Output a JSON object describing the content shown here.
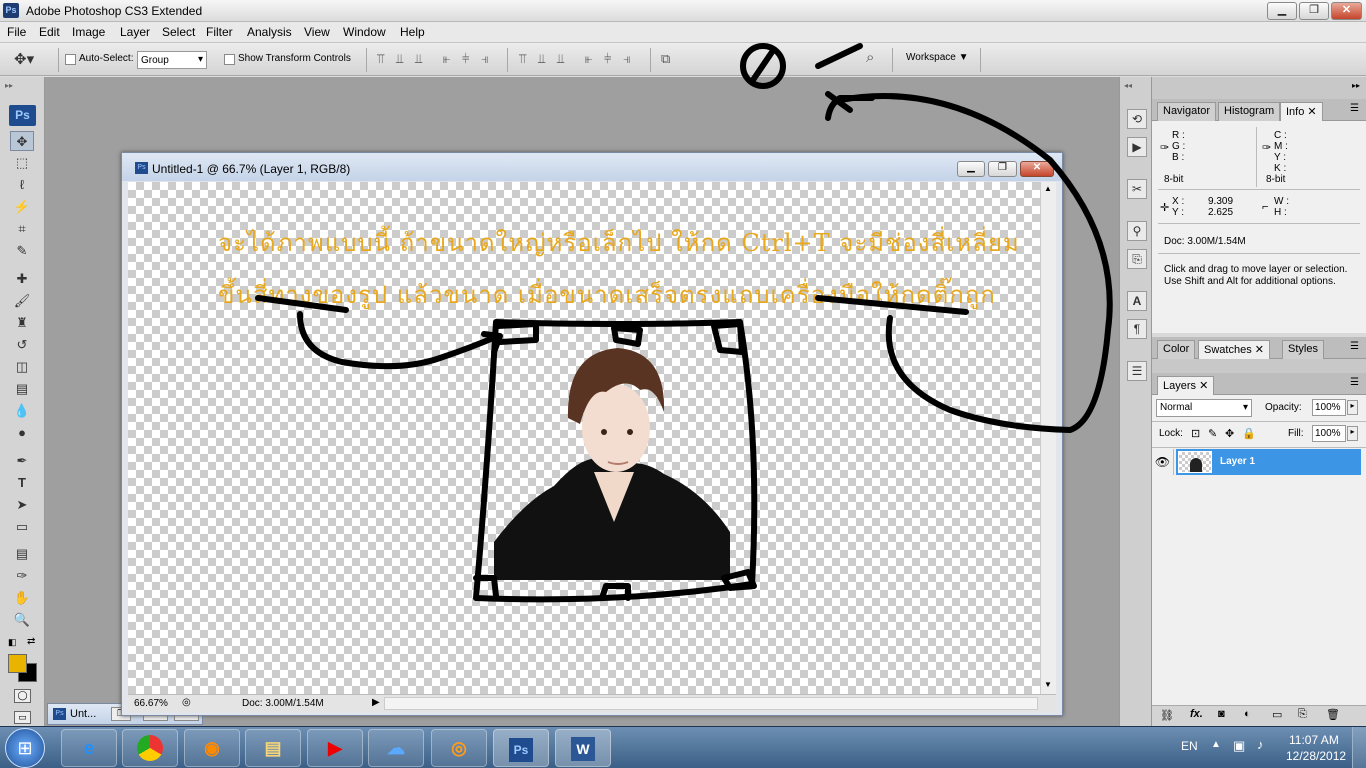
{
  "app": {
    "title": "Adobe Photoshop CS3 Extended"
  },
  "menu": [
    "File",
    "Edit",
    "Image",
    "Layer",
    "Select",
    "Filter",
    "Analysis",
    "View",
    "Window",
    "Help"
  ],
  "options": {
    "auto_select_label": "Auto-Select:",
    "auto_select_value": "Group",
    "show_transform_label": "Show Transform Controls",
    "workspace_label": "Workspace"
  },
  "document": {
    "title": "Untitled-1 @ 66.7% (Layer 1, RGB/8)",
    "zoom": "66.67%",
    "doc_size": "Doc: 3.00M/1.54M",
    "canvas_text_line1": "จะได้ภาพแบบนี้ ถ้าขนาดใหญ่หรือเล็กไป ให้กด Ctrl+T จะมีช่องสี่เหลี่ยม",
    "canvas_text_line2": "ขึ้นสี่ทางของรูป แล้วขนาด เมื่อขนาดเสร็จตรงแถบเครื่องมือให้กดติ๊กถูก"
  },
  "minimized_doc": {
    "label": "Unt..."
  },
  "info_panel": {
    "tabs": [
      "Navigator",
      "Histogram",
      "Info"
    ],
    "rgb_labels": [
      "R :",
      "G :",
      "B :"
    ],
    "cmyk_labels": [
      "C :",
      "M :",
      "Y :",
      "K :"
    ],
    "bit_left": "8-bit",
    "bit_right": "8-bit",
    "x_label": "X :",
    "x_value": "9.309",
    "y_label": "Y :",
    "y_value": "2.625",
    "w_label": "W :",
    "h_label": "H :",
    "doc_size": "Doc: 3.00M/1.54M",
    "help_text": "Click and drag to move layer or selection.  Use Shift and Alt for additional options."
  },
  "color_panel": {
    "tabs": [
      "Color",
      "Swatches",
      "Styles"
    ]
  },
  "layers_panel": {
    "tab": "Layers",
    "blend_mode": "Normal",
    "opacity_label": "Opacity:",
    "opacity_value": "100%",
    "lock_label": "Lock:",
    "fill_label": "Fill:",
    "fill_value": "100%",
    "layer_name": "Layer 1"
  },
  "taskbar": {
    "language": "EN",
    "time": "11:07 AM",
    "date": "12/28/2012"
  },
  "colors": {
    "foreground": "#e8b400",
    "background": "#000000",
    "selected_layer": "#3d95e6",
    "annotation_text": "#e8a81e"
  }
}
